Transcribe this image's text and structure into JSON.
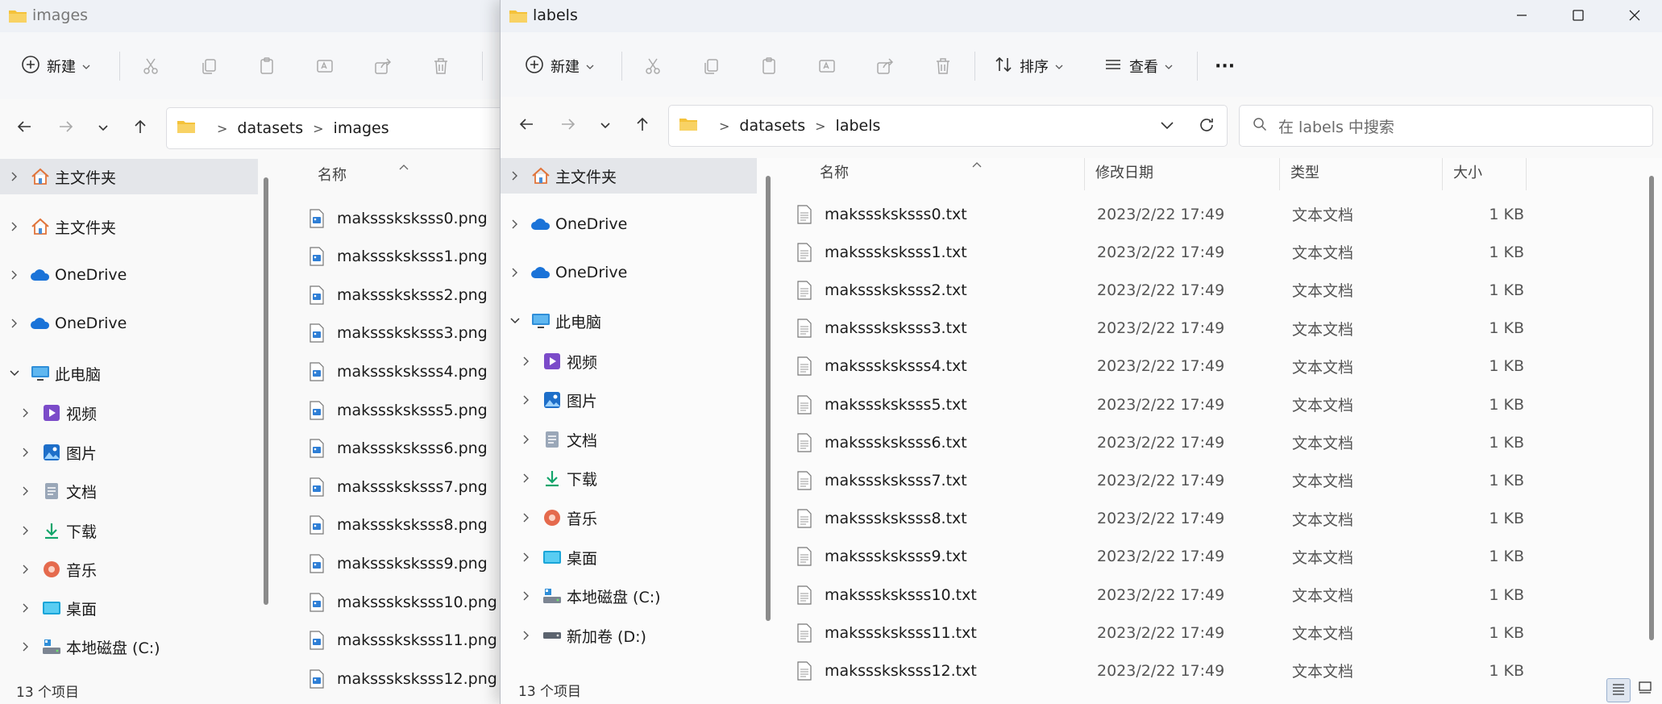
{
  "colors": {
    "accent": "#005fb8",
    "folder": "#f4c23a",
    "selected_bg": "#e4e6ea"
  },
  "back_window": {
    "title": "images",
    "toolbar": {
      "new_label": "新建"
    },
    "breadcrumb": [
      "datasets",
      "images"
    ],
    "nav_items": [
      {
        "label": "主文件夹",
        "icon": "home-icon",
        "selected": true
      },
      {
        "label": "主文件夹",
        "icon": "home-icon"
      },
      {
        "label": "OneDrive",
        "icon": "onedrive-cloud-icon"
      },
      {
        "label": "OneDrive",
        "icon": "onedrive-cloud-icon"
      },
      {
        "label": "此电脑",
        "icon": "this-pc-icon",
        "expanded": true
      },
      {
        "label": "视频",
        "icon": "videos-icon",
        "child": true
      },
      {
        "label": "图片",
        "icon": "pictures-icon",
        "child": true
      },
      {
        "label": "文档",
        "icon": "documents-icon",
        "child": true
      },
      {
        "label": "下载",
        "icon": "downloads-icon",
        "child": true
      },
      {
        "label": "音乐",
        "icon": "music-icon",
        "child": true
      },
      {
        "label": "桌面",
        "icon": "desktop-icon",
        "child": true
      },
      {
        "label": "本地磁盘 (C:)",
        "icon": "local-disk-icon",
        "child": true
      }
    ],
    "columns": {
      "name": "名称"
    },
    "files": [
      "maksssksksss0.png",
      "maksssksksss1.png",
      "maksssksksss2.png",
      "maksssksksss3.png",
      "maksssksksss4.png",
      "maksssksksss5.png",
      "maksssksksss6.png",
      "maksssksksss7.png",
      "maksssksksss8.png",
      "maksssksksss9.png",
      "maksssksksss10.png",
      "maksssksksss11.png",
      "maksssksksss12.png"
    ],
    "status": "13 个项目"
  },
  "front_window": {
    "title": "labels",
    "toolbar": {
      "new_label": "新建",
      "sort_label": "排序",
      "view_label": "查看",
      "more_label": "···"
    },
    "breadcrumb": [
      "datasets",
      "labels"
    ],
    "search_placeholder": "在 labels 中搜索",
    "nav_items": [
      {
        "label": "主文件夹",
        "icon": "home-icon",
        "selected": true
      },
      {
        "label": "OneDrive",
        "icon": "onedrive-cloud-icon"
      },
      {
        "label": "OneDrive",
        "icon": "onedrive-cloud-icon"
      },
      {
        "label": "此电脑",
        "icon": "this-pc-icon",
        "expanded": true
      },
      {
        "label": "视频",
        "icon": "videos-icon",
        "child": true
      },
      {
        "label": "图片",
        "icon": "pictures-icon",
        "child": true
      },
      {
        "label": "文档",
        "icon": "documents-icon",
        "child": true
      },
      {
        "label": "下载",
        "icon": "downloads-icon",
        "child": true
      },
      {
        "label": "音乐",
        "icon": "music-icon",
        "child": true
      },
      {
        "label": "桌面",
        "icon": "desktop-icon",
        "child": true
      },
      {
        "label": "本地磁盘 (C:)",
        "icon": "local-disk-icon",
        "child": true
      },
      {
        "label": "新加卷 (D:)",
        "icon": "drive-icon",
        "child": true
      }
    ],
    "columns": {
      "name": "名称",
      "modified": "修改日期",
      "type": "类型",
      "size": "大小"
    },
    "files": [
      {
        "name": "maksssksksss0.txt",
        "modified": "2023/2/22 17:49",
        "type": "文本文档",
        "size": "1 KB"
      },
      {
        "name": "maksssksksss1.txt",
        "modified": "2023/2/22 17:49",
        "type": "文本文档",
        "size": "1 KB"
      },
      {
        "name": "maksssksksss2.txt",
        "modified": "2023/2/22 17:49",
        "type": "文本文档",
        "size": "1 KB"
      },
      {
        "name": "maksssksksss3.txt",
        "modified": "2023/2/22 17:49",
        "type": "文本文档",
        "size": "1 KB"
      },
      {
        "name": "maksssksksss4.txt",
        "modified": "2023/2/22 17:49",
        "type": "文本文档",
        "size": "1 KB"
      },
      {
        "name": "maksssksksss5.txt",
        "modified": "2023/2/22 17:49",
        "type": "文本文档",
        "size": "1 KB"
      },
      {
        "name": "maksssksksss6.txt",
        "modified": "2023/2/22 17:49",
        "type": "文本文档",
        "size": "1 KB"
      },
      {
        "name": "maksssksksss7.txt",
        "modified": "2023/2/22 17:49",
        "type": "文本文档",
        "size": "1 KB"
      },
      {
        "name": "maksssksksss8.txt",
        "modified": "2023/2/22 17:49",
        "type": "文本文档",
        "size": "1 KB"
      },
      {
        "name": "maksssksksss9.txt",
        "modified": "2023/2/22 17:49",
        "type": "文本文档",
        "size": "1 KB"
      },
      {
        "name": "maksssksksss10.txt",
        "modified": "2023/2/22 17:49",
        "type": "文本文档",
        "size": "1 KB"
      },
      {
        "name": "maksssksksss11.txt",
        "modified": "2023/2/22 17:49",
        "type": "文本文档",
        "size": "1 KB"
      },
      {
        "name": "maksssksksss12.txt",
        "modified": "2023/2/22 17:49",
        "type": "文本文档",
        "size": "1 KB"
      }
    ],
    "status": "13 个项目"
  }
}
